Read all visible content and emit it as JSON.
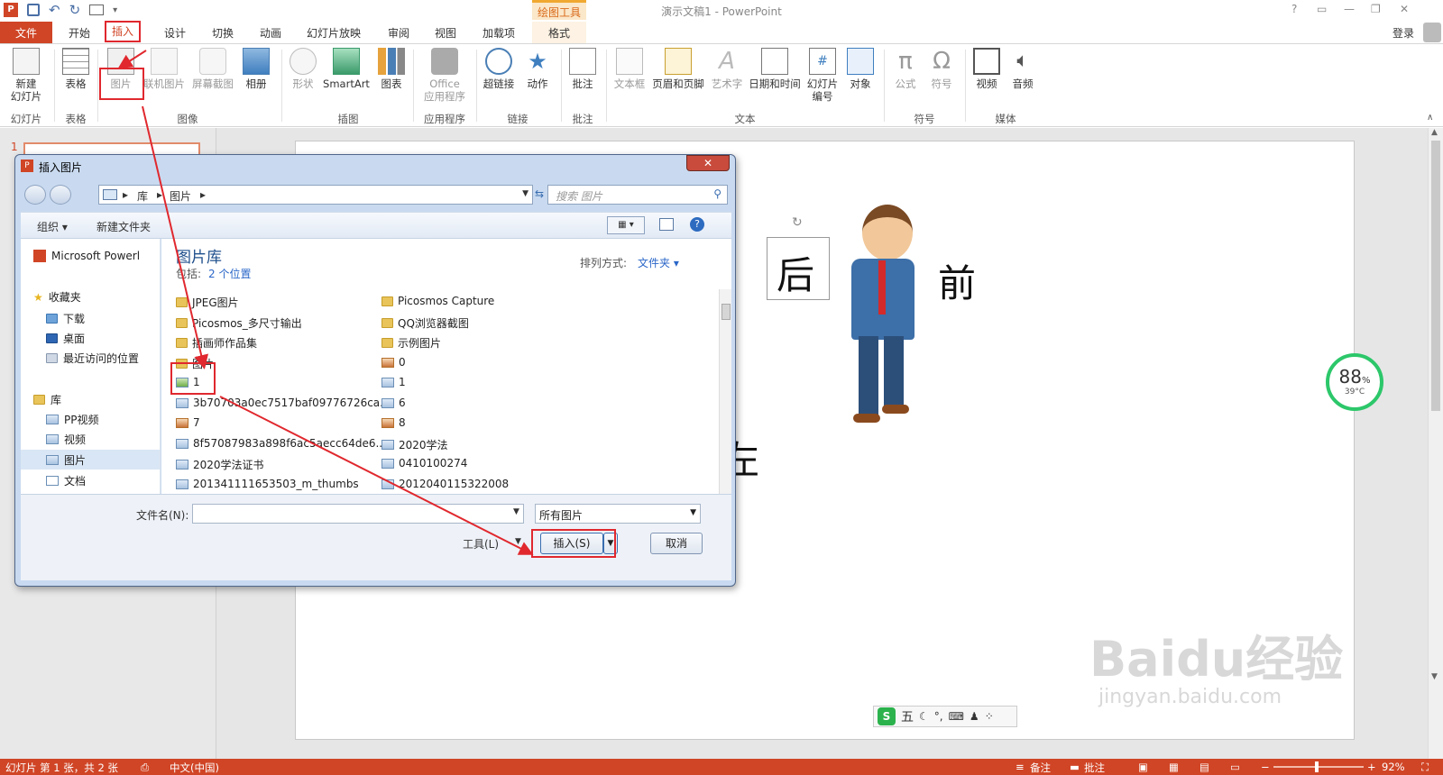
{
  "window": {
    "title": "演示文稿1 - PowerPoint",
    "contextual_group": "绘图工具",
    "help": "?",
    "signin": "登录"
  },
  "tabs": [
    "文件",
    "开始",
    "插入",
    "设计",
    "切换",
    "动画",
    "幻灯片放映",
    "审阅",
    "视图",
    "加载项",
    "格式"
  ],
  "ribbon": {
    "new_slide": "新建\n幻灯片",
    "table": "表格",
    "picture": "图片",
    "online_picture": "联机图片",
    "screenshot": "屏幕截图",
    "album": "相册",
    "shapes": "形状",
    "smartart": "SmartArt",
    "chart": "图表",
    "office_apps": "Office\n应用程序",
    "hyperlink": "超链接",
    "action": "动作",
    "comment": "批注",
    "textbox": "文本框",
    "header_footer": "页眉和页脚",
    "wordart": "艺术字",
    "datetime": "日期和时间",
    "slide_number": "幻灯片\n编号",
    "object": "对象",
    "equation": "公式",
    "symbol": "符号",
    "video": "视频",
    "audio": "音频",
    "groups": {
      "slides": "幻灯片",
      "tables": "表格",
      "images": "图像",
      "illustrations": "插图",
      "apps": "应用程序",
      "links": "链接",
      "comments": "批注",
      "text": "文本",
      "symbols": "符号",
      "media": "媒体"
    }
  },
  "slide": {
    "text_back": "后",
    "text_front": "前",
    "text_left": "左"
  },
  "widget": {
    "percent": "88",
    "percent_sign": "%",
    "temp": "39°C"
  },
  "ime_bar": {
    "logo": "S",
    "label": "五"
  },
  "watermark": {
    "brand": "Baidu经验",
    "url": "jingyan.baidu.com"
  },
  "dialog": {
    "title": "插入图片",
    "close": "✕",
    "breadcrumb": [
      "库",
      "图片"
    ],
    "search_placeholder": "搜索 图片",
    "organize": "组织 ▾",
    "new_folder": "新建文件夹",
    "nav": {
      "app": "Microsoft Powerl",
      "favorites": "收藏夹",
      "downloads": "下载",
      "desktop": "桌面",
      "recent": "最近访问的位置",
      "libraries": "库",
      "pp_video": "PP视频",
      "video": "视频",
      "pictures": "图片",
      "documents": "文档"
    },
    "library_title": "图片库",
    "library_includes": "包括:",
    "library_locations": "2 个位置",
    "sort_label": "排列方式:",
    "sort_value": "文件夹 ▾",
    "files_left": [
      "JPEG图片",
      "Picosmos_多尺寸输出",
      "插画师作品集",
      "图片",
      "1",
      "3b70703a0ec7517baf09776726ca...",
      "7",
      "8f57087983a898f6ac5aecc64de6...",
      "2020学法证书",
      "201341111653503_m_thumbs"
    ],
    "files_right": [
      "Picosmos Capture",
      "QQ浏览器截图",
      "示例图片",
      "0",
      "1",
      "6",
      "8",
      "2020学法",
      "0410100274",
      "2012040115322008"
    ],
    "filename_label": "文件名(N):",
    "filename_value": "",
    "filetype": "所有图片",
    "tools": "工具(L)",
    "insert": "插入(S)",
    "cancel": "取消"
  },
  "status": {
    "slide_info": "幻灯片 第 1 张，共 2 张",
    "language": "中文(中国)",
    "notes": "备注",
    "comments": "批注",
    "zoom": "92%"
  }
}
